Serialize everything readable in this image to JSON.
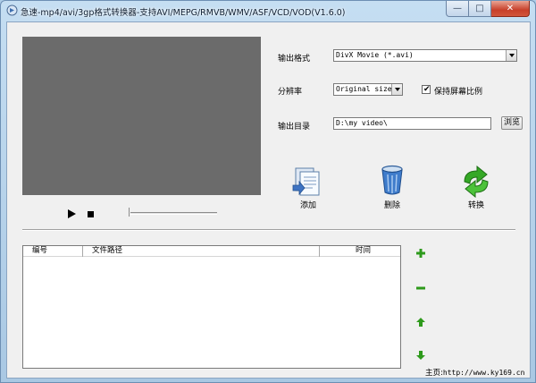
{
  "window": {
    "title": "急速-mp4/avi/3gp格式转换器-支持AVI/MEPG/RMVB/WMV/ASF/VCD/VOD(V1.6.0)",
    "buttons": {
      "minimize": "—",
      "maximize": "□",
      "close": "✕"
    }
  },
  "settings": {
    "format_label": "输出格式",
    "format_value": "DivX Movie (*.avi)",
    "resolution_label": "分辨率",
    "resolution_value": "Original size",
    "keep_ratio_label": "保持屏幕比例",
    "keep_ratio_checked": true,
    "output_dir_label": "输出目录",
    "output_dir_value": "D:\\my video\\",
    "browse_label": "浏览"
  },
  "toolbar": {
    "add_label": "添加",
    "delete_label": "删除",
    "convert_label": "转换"
  },
  "file_list": {
    "columns": [
      "编号",
      "文件路径",
      "时间"
    ],
    "rows": []
  },
  "footer": {
    "homepage_label": "主页:",
    "homepage_url": "http://www.ky169.cn"
  },
  "icons": {
    "play": "play-icon",
    "stop": "stop-icon",
    "add": "add-files-icon",
    "delete": "trash-icon",
    "convert": "convert-arrows-icon",
    "list_add": "plus-icon",
    "list_remove": "minus-icon",
    "move_up": "arrow-up-icon",
    "move_down": "arrow-down-icon"
  },
  "colors": {
    "accent_green": "#2e9a1c",
    "video_bg": "#6b6b6b",
    "panel_bg": "#f0f0f0"
  }
}
